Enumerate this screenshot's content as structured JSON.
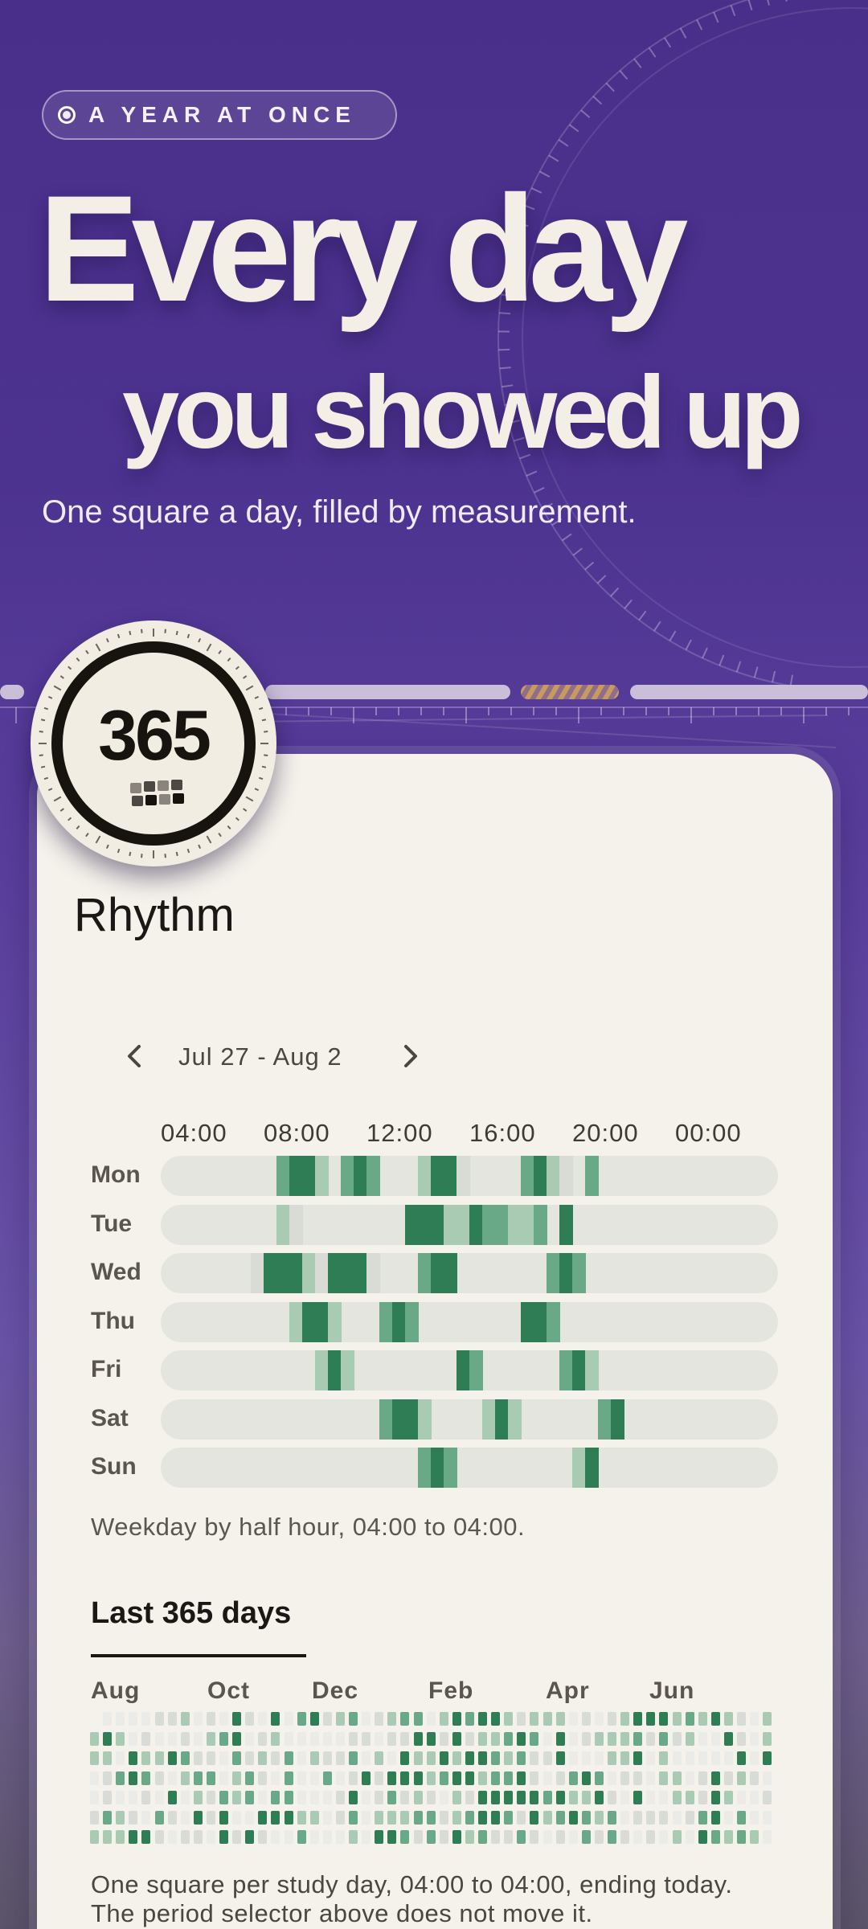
{
  "hero": {
    "kicker": "A YEAR AT ONCE",
    "title_line1": "Every day",
    "title_line2": "you showed up",
    "subtitle": "One square a day, filled by measurement."
  },
  "badge": {
    "number": "365"
  },
  "rhythm": {
    "title": "Rhythm",
    "date_range": "Jul 27 - Aug 2",
    "hour_labels": [
      "04:00",
      "08:00",
      "12:00",
      "16:00",
      "20:00",
      "00:00"
    ],
    "days": [
      {
        "label": "Mon",
        "slots": [
          [
            9,
            3
          ],
          [
            10,
            4
          ],
          [
            11,
            4
          ],
          [
            12,
            2
          ],
          [
            14,
            3
          ],
          [
            15,
            4
          ],
          [
            16,
            3
          ],
          [
            20,
            2
          ],
          [
            21,
            4
          ],
          [
            22,
            4
          ],
          [
            23,
            1
          ],
          [
            28,
            3
          ],
          [
            29,
            4
          ],
          [
            30,
            2
          ],
          [
            31,
            1
          ],
          [
            33,
            3
          ]
        ]
      },
      {
        "label": "Tue",
        "slots": [
          [
            9,
            2
          ],
          [
            10,
            1
          ],
          [
            19,
            4
          ],
          [
            20,
            4
          ],
          [
            21,
            4
          ],
          [
            22,
            2
          ],
          [
            23,
            2
          ],
          [
            24,
            4
          ],
          [
            25,
            3
          ],
          [
            26,
            3
          ],
          [
            27,
            2
          ],
          [
            28,
            2
          ],
          [
            29,
            3
          ],
          [
            31,
            4
          ]
        ]
      },
      {
        "label": "Wed",
        "slots": [
          [
            7,
            1
          ],
          [
            8,
            4
          ],
          [
            9,
            4
          ],
          [
            10,
            4
          ],
          [
            11,
            2
          ],
          [
            12,
            1
          ],
          [
            13,
            4
          ],
          [
            14,
            4
          ],
          [
            15,
            4
          ],
          [
            16,
            1
          ],
          [
            20,
            3
          ],
          [
            21,
            4
          ],
          [
            22,
            4
          ],
          [
            30,
            3
          ],
          [
            31,
            4
          ],
          [
            32,
            3
          ]
        ]
      },
      {
        "label": "Thu",
        "slots": [
          [
            10,
            2
          ],
          [
            11,
            4
          ],
          [
            12,
            4
          ],
          [
            13,
            2
          ],
          [
            17,
            3
          ],
          [
            18,
            4
          ],
          [
            19,
            3
          ],
          [
            28,
            4
          ],
          [
            29,
            4
          ],
          [
            30,
            3
          ]
        ]
      },
      {
        "label": "Fri",
        "slots": [
          [
            12,
            2
          ],
          [
            13,
            4
          ],
          [
            14,
            2
          ],
          [
            23,
            4
          ],
          [
            24,
            3
          ],
          [
            31,
            3
          ],
          [
            32,
            4
          ],
          [
            33,
            2
          ]
        ]
      },
      {
        "label": "Sat",
        "slots": [
          [
            17,
            3
          ],
          [
            18,
            4
          ],
          [
            19,
            4
          ],
          [
            20,
            2
          ],
          [
            25,
            2
          ],
          [
            26,
            4
          ],
          [
            27,
            2
          ],
          [
            34,
            3
          ],
          [
            35,
            4
          ]
        ]
      },
      {
        "label": "Sun",
        "slots": [
          [
            20,
            3
          ],
          [
            21,
            4
          ],
          [
            22,
            3
          ],
          [
            32,
            2
          ],
          [
            33,
            4
          ]
        ]
      }
    ],
    "caption": "Weekday by half hour, 04:00 to 04:00."
  },
  "year": {
    "title": "Last 365 days",
    "months": [
      "Aug",
      "Oct",
      "Dec",
      "Feb",
      "Apr",
      "Jun"
    ],
    "caption": "One square per study day, 04:00 to 04:00, ending today. The period selector above does not move it."
  },
  "colors": {
    "level1": "#d9dcd6",
    "level2": "#a9cbb4",
    "level3": "#6aa987",
    "level4": "#2e7d54",
    "empty": "#ebebe7",
    "accent_purple": "#4a2f8a"
  },
  "icons": {
    "prev": "chevron-left-icon",
    "next": "chevron-right-icon",
    "badge": "calendar-grid-icon"
  }
}
